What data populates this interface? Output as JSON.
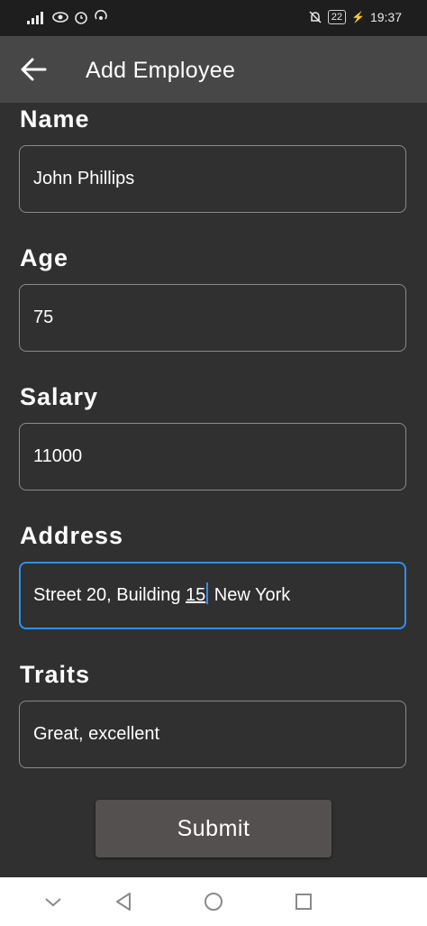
{
  "status_bar": {
    "time": "19:37",
    "battery": "22"
  },
  "app_bar": {
    "title": "Add Employee"
  },
  "form": {
    "name": {
      "label": "Name",
      "value": "John Phillips"
    },
    "age": {
      "label": "Age",
      "value": "75"
    },
    "salary": {
      "label": "Salary",
      "value": "11000"
    },
    "address": {
      "label": "Address",
      "value_before": "Street 20, Building ",
      "value_underlined": "15",
      "value_after": " New York"
    },
    "traits": {
      "label": "Traits",
      "value": "Great, excellent"
    }
  },
  "submit_label": "Submit",
  "colors": {
    "background": "#303030",
    "app_bar": "#474747",
    "focus": "#2f8ff0",
    "button": "#545050"
  }
}
